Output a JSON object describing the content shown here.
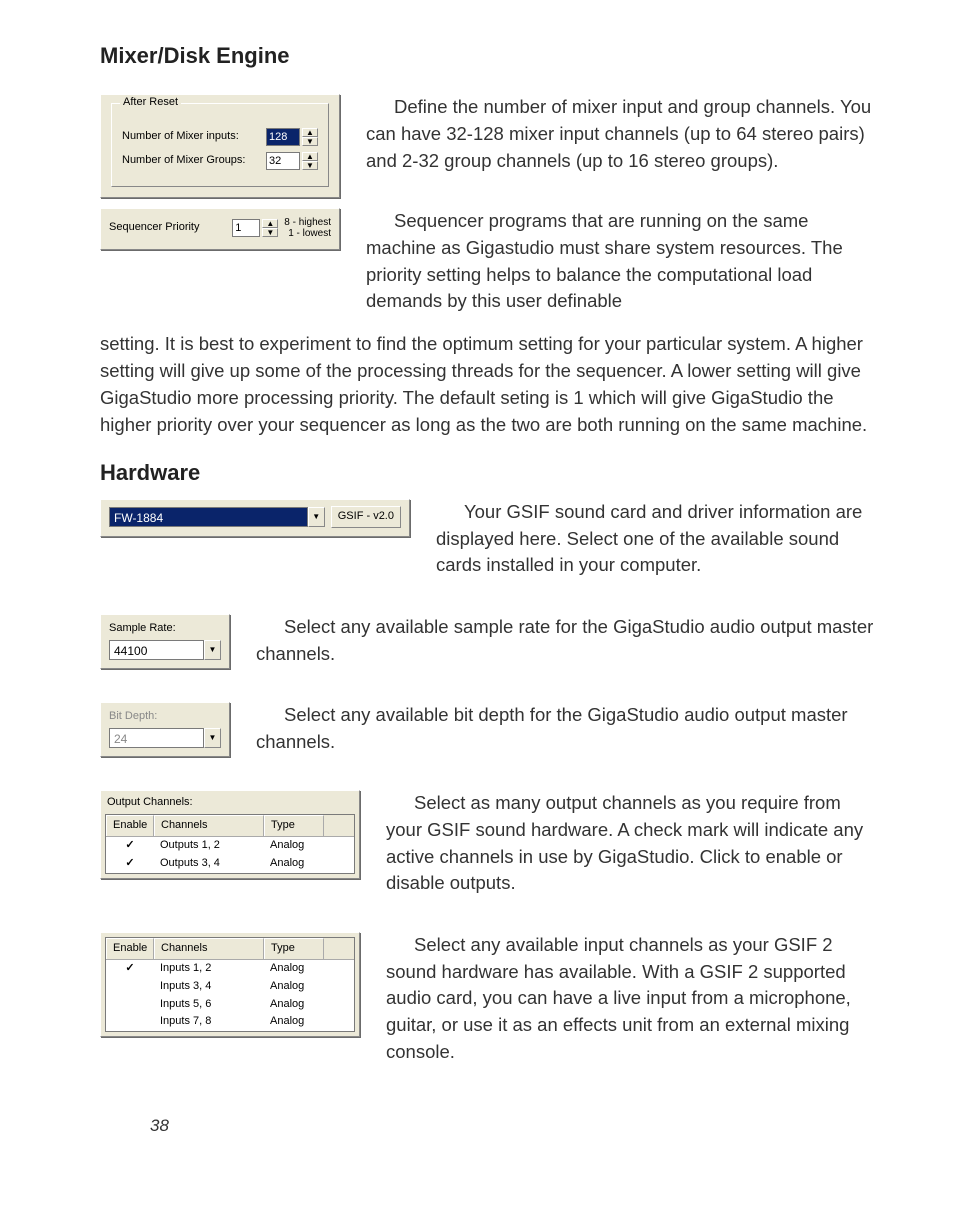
{
  "headings": {
    "mixer": "Mixer/Disk Engine",
    "hardware": "Hardware"
  },
  "after_reset": {
    "group_title": "After Reset",
    "inputs_label": "Number of Mixer inputs:",
    "inputs_value": "128",
    "groups_label": "Number of Mixer Groups:",
    "groups_value": "32"
  },
  "sequencer": {
    "label": "Sequencer Priority",
    "value": "1",
    "legend_high": "8 - highest",
    "legend_low": "1 - lowest"
  },
  "gsif_card": {
    "device": "FW-1884",
    "badge": "GSIF - v2.0"
  },
  "sample_rate": {
    "label": "Sample Rate:",
    "value": "44100"
  },
  "bit_depth": {
    "label": "Bit Depth:",
    "value": "24"
  },
  "output_channels": {
    "title": "Output Channels:",
    "cols": {
      "enable": "Enable",
      "channels": "Channels",
      "type": "Type"
    },
    "rows": [
      {
        "enable": "✓",
        "channels": "Outputs 1, 2",
        "type": "Analog"
      },
      {
        "enable": "✓",
        "channels": "Outputs 3, 4",
        "type": "Analog"
      }
    ]
  },
  "input_channels": {
    "cols": {
      "enable": "Enable",
      "channels": "Channels",
      "type": "Type"
    },
    "rows": [
      {
        "enable": "✓",
        "channels": "Inputs 1, 2",
        "type": "Analog"
      },
      {
        "enable": "",
        "channels": "Inputs 3, 4",
        "type": "Analog"
      },
      {
        "enable": "",
        "channels": "Inputs 5, 6",
        "type": "Analog"
      },
      {
        "enable": "",
        "channels": "Inputs 7, 8",
        "type": "Analog"
      }
    ]
  },
  "paragraphs": {
    "mixer1": "Define the number of mixer input and group channels. You can have 32-128 mixer input channels (up to 64 stereo pairs) and 2-32 group channels (up to 16 stereo groups).",
    "mixer2a": "Sequencer programs that are running on the same machine as Gigastudio must share system resources. The priority setting helps to balance the computational load demands by this user definable",
    "mixer2b": "setting. It is best to experiment to find the optimum setting for your particular system. A higher setting will give up some of the processing threads for the sequencer. A lower setting will give GigaStudio more processing priority. The default seting is 1 which will give GigaStudio the higher priority over your sequencer as long as the two are both running on the same machine.",
    "hw1": "Your GSIF sound card and driver information are displayed here. Select one of the available sound cards installed in your computer.",
    "hw2": "Select any available sample rate for the GigaStudio audio output master channels.",
    "hw3": "Select any available bit depth for the GigaStudio audio output master channels.",
    "hw4": "Select as many output channels as you require from your GSIF sound hardware. A check mark will indicate any active channels in use by GigaStudio. Click to enable or disable outputs.",
    "hw5": "Select any available input channels as your GSIF 2 sound hardware has available. With a GSIF 2 supported audio card, you can have a live input from a microphone, guitar, or use it as an effects unit from an external mixing console."
  },
  "page_number": "38"
}
